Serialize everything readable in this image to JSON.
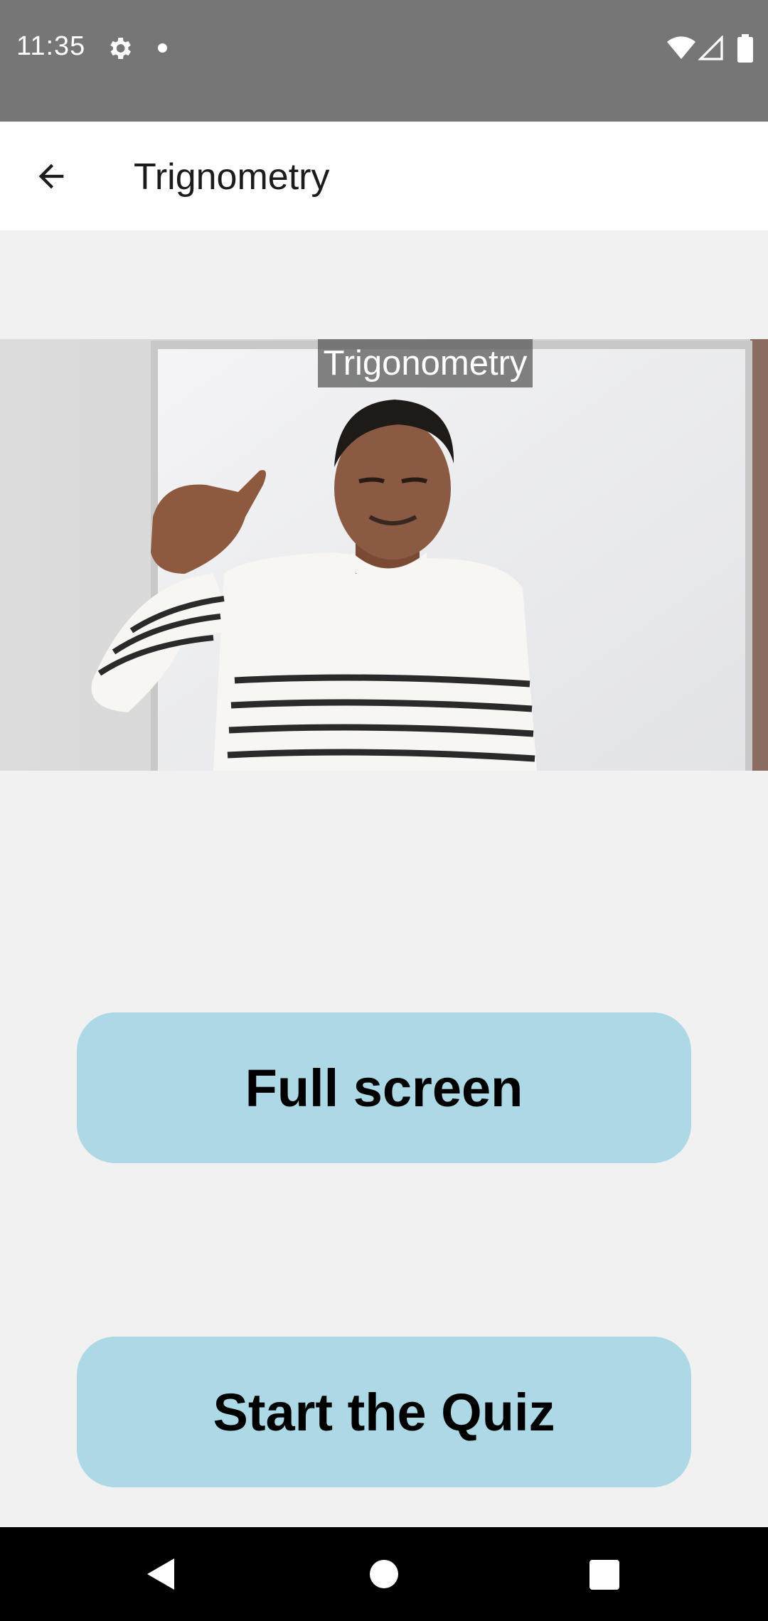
{
  "status_bar": {
    "time": "11:35",
    "icons": [
      "gear-icon",
      "dot-icon",
      "wifi-icon",
      "signal-icon",
      "battery-icon"
    ]
  },
  "app_bar": {
    "title": "Trignometry",
    "back_icon": "arrow-back-icon"
  },
  "video": {
    "caption": "Trigonometry"
  },
  "buttons": {
    "full_screen": "Full screen",
    "start_quiz": "Start the Quiz"
  },
  "nav_bar": {
    "icons": [
      "nav-back-icon",
      "nav-home-icon",
      "nav-recents-icon"
    ]
  },
  "colors": {
    "status_bar": "#767676",
    "app_bar": "#ffffff",
    "background": "#f1f1f1",
    "button": "#add8e6",
    "nav_bar": "#000000"
  }
}
